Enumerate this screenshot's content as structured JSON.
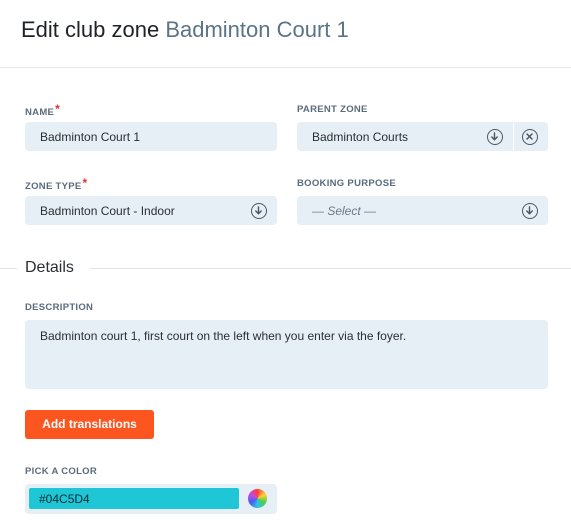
{
  "header": {
    "title_prefix": "Edit club zone",
    "title_zone": "Badminton Court 1"
  },
  "form": {
    "name": {
      "label": "NAME",
      "required_mark": "*",
      "value": "Badminton Court 1"
    },
    "parent_zone": {
      "label": "PARENT ZONE",
      "value": "Badminton Courts"
    },
    "zone_type": {
      "label": "ZONE TYPE",
      "required_mark": "*",
      "value": "Badminton Court - Indoor"
    },
    "booking_purpose": {
      "label": "BOOKING PURPOSE",
      "value": "— Select —"
    }
  },
  "details": {
    "section_title": "Details",
    "description": {
      "label": "DESCRIPTION",
      "value": "Badminton court 1, first court on the left when you enter via the foyer."
    },
    "add_translations_label": "Add translations",
    "color": {
      "label": "PICK A COLOR",
      "value": "#04C5D4",
      "swatch_color": "#1ec6d6"
    }
  },
  "colors": {
    "accent": "#fd5520",
    "field_bg": "#e6eef6",
    "title_accent": "#5a7487"
  },
  "icons": [
    "chevron-down-circle-icon",
    "clear-circle-icon",
    "color-wheel-icon"
  ]
}
